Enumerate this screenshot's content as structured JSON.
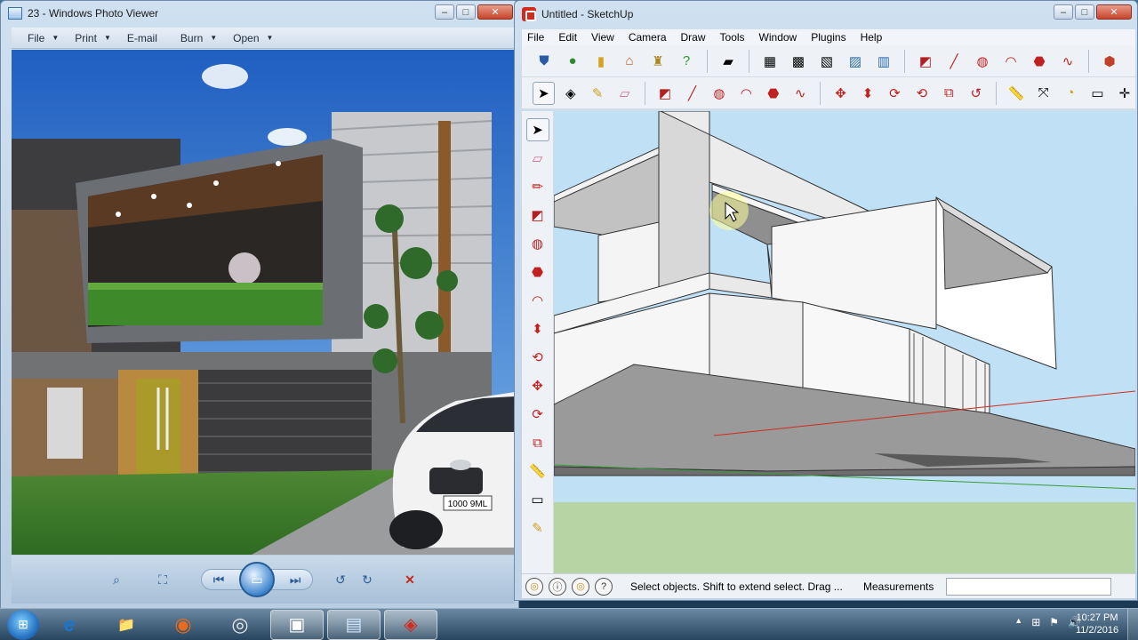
{
  "photo_viewer": {
    "title": "23 - Windows Photo Viewer",
    "menu": [
      {
        "label": "File",
        "caret": "▼"
      },
      {
        "label": "Print",
        "caret": "▼"
      },
      {
        "label": "E-mail",
        "caret": ""
      },
      {
        "label": "Burn",
        "caret": "▼"
      },
      {
        "label": "Open",
        "caret": "▼"
      }
    ],
    "car_plate": "1000 9ML",
    "controls": {
      "zoom": "⌕",
      "fit": "⛶",
      "prev": "⏮",
      "slideshow": "▭",
      "next": "⏭",
      "rotate_left": "↺",
      "rotate_right": "↻",
      "delete": "✕"
    }
  },
  "sketchup": {
    "title": "Untitled - SketchUp",
    "menu": [
      "File",
      "Edit",
      "View",
      "Camera",
      "Draw",
      "Tools",
      "Window",
      "Plugins",
      "Help"
    ],
    "status": {
      "hint": "Select objects. Shift to extend select. Drag ...",
      "measurements_label": "Measurements",
      "measurements_value": ""
    }
  },
  "window_controls": {
    "minimize": "–",
    "maximize": "□",
    "close": "✕"
  },
  "taskbar": {
    "start": "⊞",
    "time": "10:27 PM",
    "date": "11/2/2016",
    "tray": {
      "arrow": "▲",
      "network": "⊞",
      "flag": "⚑",
      "volume": "🔊"
    },
    "apps": [
      {
        "name": "internet-explorer",
        "glyph": "e",
        "color": "#1a74d2"
      },
      {
        "name": "file-explorer",
        "glyph": "📁",
        "color": "#e8b84a"
      },
      {
        "name": "firefox",
        "glyph": "◉",
        "color": "#e66a1f"
      },
      {
        "name": "chrome",
        "glyph": "◎",
        "color": "#3c8b3c"
      },
      {
        "name": "photo-viewer-task",
        "glyph": "▣",
        "color": "#ffffff"
      },
      {
        "name": "image-app",
        "glyph": "▤",
        "color": "#6fb2e6"
      },
      {
        "name": "sketchup-task",
        "glyph": "◈",
        "color": "#d12a1e"
      }
    ]
  },
  "colors": {
    "sketchup_red": "#d12a1e",
    "sky": "#bfe0f5",
    "ground": "#b7d4a4",
    "axis_red": "#d12a1e",
    "axis_green": "#3a9a3a"
  }
}
